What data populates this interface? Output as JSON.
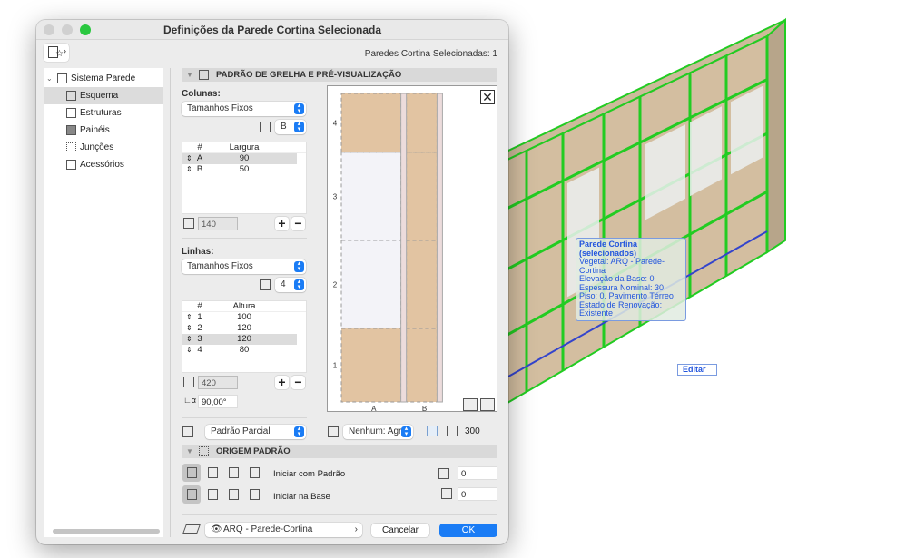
{
  "dialog": {
    "title": "Definições da Parede Cortina Selecionada",
    "selected_count": "Paredes Cortina Selecionadas: 1"
  },
  "sidebar": {
    "root": "Sistema Parede Cortina",
    "items": [
      {
        "label": "Esquema",
        "icon": "scheme-icon",
        "selected": true
      },
      {
        "label": "Estruturas",
        "icon": "frames-icon"
      },
      {
        "label": "Painéis",
        "icon": "panels-icon"
      },
      {
        "label": "Junções",
        "icon": "junctions-icon"
      },
      {
        "label": "Acessórios",
        "icon": "accessories-icon"
      }
    ]
  },
  "grid_section": {
    "title": "PADRÃO DE GRELHA E PRÉ-VISUALIZAÇÃO",
    "columns_label": "Colunas:",
    "columns_mode": "Tamanhos Fixos",
    "columns_count": "B",
    "columns_table": {
      "headers": [
        "#",
        "Largura"
      ],
      "rows": [
        {
          "id": "A",
          "value": "90",
          "selected": true
        },
        {
          "id": "B",
          "value": "50"
        }
      ]
    },
    "columns_total": "140",
    "rows_label": "Linhas:",
    "rows_mode": "Tamanhos Fixos",
    "rows_count": "4",
    "rows_table": {
      "headers": [
        "#",
        "Altura"
      ],
      "rows": [
        {
          "id": "1",
          "value": "100"
        },
        {
          "id": "2",
          "value": "120"
        },
        {
          "id": "3",
          "value": "120",
          "selected": true
        },
        {
          "id": "4",
          "value": "80"
        }
      ]
    },
    "rows_total": "420",
    "angle": "90,00°",
    "pattern_mode": "Padrão Parcial",
    "frame_option": "Nenhum: Agr...",
    "height_value": "300",
    "preview": {
      "row_labels": [
        "1",
        "2",
        "3",
        "4"
      ],
      "column_labels": [
        "A",
        "B"
      ]
    },
    "add_label": "+",
    "remove_label": "−"
  },
  "origin_section": {
    "title": "ORIGEM PADRÃO",
    "start_pattern_label": "Iniciar com Padrão",
    "start_base_label": "Iniciar na Base",
    "offset_horizontal": "0",
    "offset_vertical": "0"
  },
  "footer": {
    "layer": "ARQ - Parede-Cortina",
    "cancel": "Cancelar",
    "ok": "OK"
  },
  "viewport": {
    "tooltip": {
      "title": "Parede Cortina (selecionados)",
      "lines": [
        "Vegetal: ARQ - Parede-Cortina",
        "Elevação da Base: 0",
        "Espessura Nominal: 30",
        "Piso: 0. Pavimento Térreo",
        "Estado de Renovação: Existente"
      ]
    },
    "edit_button": "Editar"
  },
  "colors": {
    "accent": "#1a7cf5",
    "selection_green": "#22cc22",
    "panel_tan": "#e2c4a2",
    "tooltip_text": "#2255dd"
  }
}
